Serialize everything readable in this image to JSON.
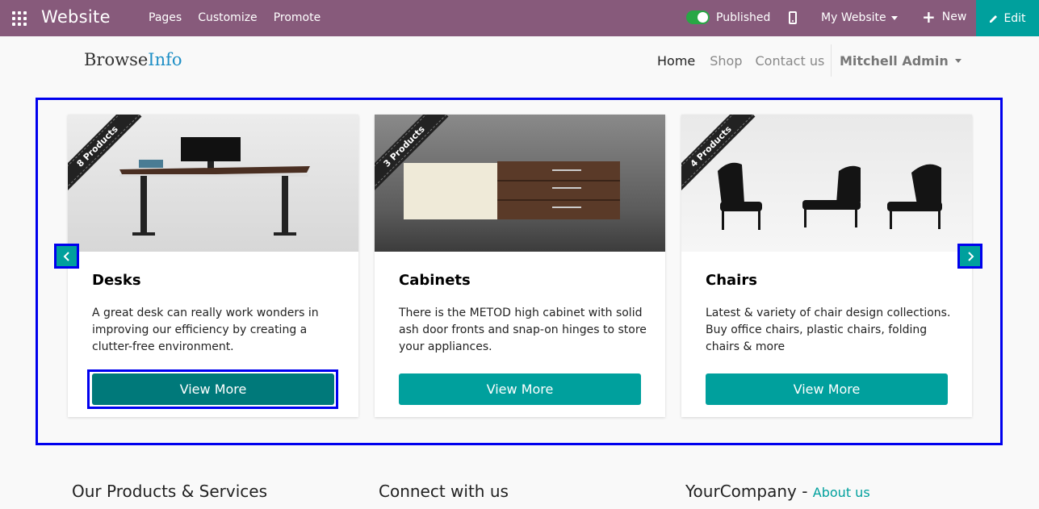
{
  "topbar": {
    "app_title": "Website",
    "menu": [
      "Pages",
      "Customize",
      "Promote"
    ],
    "published_label": "Published",
    "website_selector": "My Website",
    "new_label": "New",
    "edit_label": "Edit",
    "bg_color": "#875a7b",
    "accent_color": "#00a09d"
  },
  "site": {
    "logo_part1": "Browse",
    "logo_part2": "Info",
    "nav": {
      "home": "Home",
      "shop": "Shop",
      "contact": "Contact us",
      "user": "Mitchell Admin"
    }
  },
  "carousel": {
    "cards": [
      {
        "ribbon": "8 Products",
        "title": "Desks",
        "description": "A great desk can really work wonders in improving our efficiency by creating a clutter-free environment.",
        "button": "View More"
      },
      {
        "ribbon": "3 Products",
        "title": "Cabinets",
        "description": "There is the METOD high cabinet with solid ash door fronts and snap-on hinges to store your appliances.",
        "button": "View More"
      },
      {
        "ribbon": "4 Products",
        "title": "Chairs",
        "description": "Latest & variety of chair design collections. Buy office chairs, plastic chairs, folding chairs & more",
        "button": "View More"
      }
    ]
  },
  "footer": {
    "col1": "Our Products & Services",
    "col2": "Connect with us",
    "col3": "YourCompany",
    "col3_sep": " - ",
    "col3_link": "About us"
  }
}
